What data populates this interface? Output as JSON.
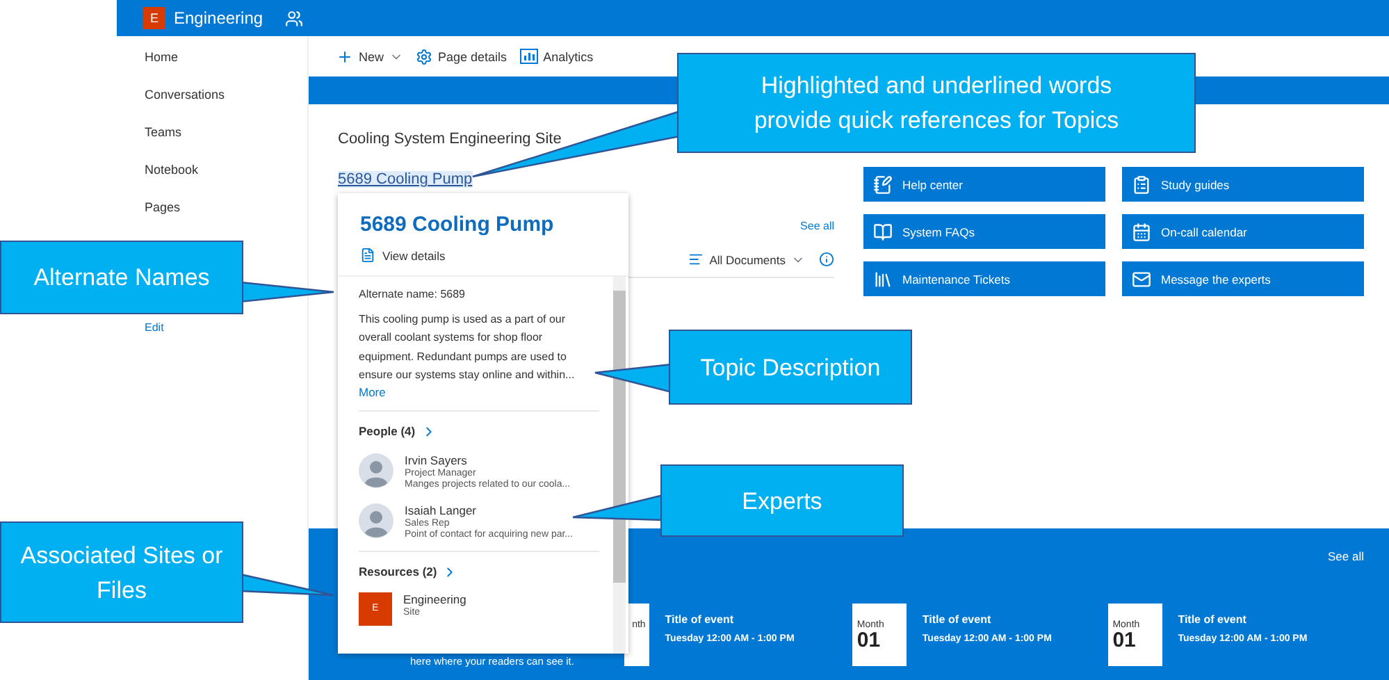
{
  "top_bar": {
    "logo_letter": "E",
    "site_name": "Engineering"
  },
  "nav": {
    "items": [
      "Home",
      "Conversations",
      "Teams",
      "Notebook",
      "Pages"
    ],
    "edit": "Edit"
  },
  "toolbar": [
    {
      "kind": "new",
      "label": "New"
    },
    {
      "kind": "details",
      "label": "Page details"
    },
    {
      "kind": "analytics",
      "label": "Analytics"
    }
  ],
  "site_title": "Cooling System Engineering Site",
  "topic_link": "5689 Cooling Pump",
  "documents": {
    "see_all": "See all",
    "view": "All Documents"
  },
  "quick_links": [
    {
      "kind": "help",
      "label": "Help center"
    },
    {
      "kind": "guide",
      "label": "Study guides"
    },
    {
      "kind": "faq",
      "label": "System FAQs"
    },
    {
      "kind": "calendar",
      "label": "On-call calendar"
    },
    {
      "kind": "tickets",
      "label": "Maintenance Tickets"
    },
    {
      "kind": "mail",
      "label": "Message the experts"
    }
  ],
  "events": {
    "see_all": "See all",
    "note": "here where your readers can see it.",
    "items": [
      {
        "cropped": true,
        "month": "nth",
        "title": "Title of event",
        "time": "Tuesday 12:00 AM - 1:00 PM"
      },
      {
        "cropped": false,
        "month": "Month",
        "day": "01",
        "title": "Title of event",
        "time": "Tuesday 12:00 AM - 1:00 PM"
      },
      {
        "cropped": false,
        "month": "Month",
        "day": "01",
        "title": "Title of event",
        "time": "Tuesday 12:00 AM - 1:00 PM"
      }
    ]
  },
  "topic_card": {
    "title": "5689 Cooling Pump",
    "view_details": "View details",
    "alternate_name": "Alternate name: 5689",
    "description": "This cooling pump is used as a part of our overall coolant systems for shop floor equipment. Redundant pumps are used to ensure our systems stay online and within...",
    "more": "More",
    "people_heading": "People (4)",
    "people": [
      {
        "name": "Irvin Sayers",
        "role": "Project Manager",
        "about": "Manges projects related to our coola..."
      },
      {
        "name": "Isaiah Langer",
        "role": "Sales Rep",
        "about": "Point of contact for acquiring new par..."
      }
    ],
    "resources_heading": "Resources (2)",
    "resources": [
      {
        "letter": "E",
        "name": "Engineering",
        "type": "Site"
      }
    ]
  },
  "callouts": [
    {
      "text": "Highlighted and underlined words provide quick references for Topics"
    },
    {
      "text": "Alternate Names"
    },
    {
      "text": "Topic Description"
    },
    {
      "text": "Experts"
    },
    {
      "text": "Associated Sites or Files"
    }
  ]
}
